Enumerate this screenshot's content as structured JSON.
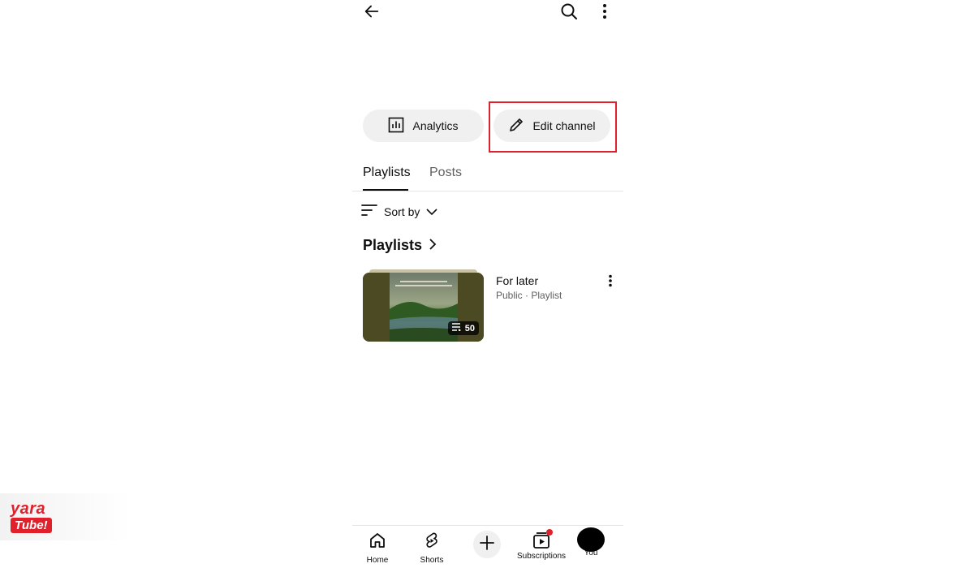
{
  "topbar": {
    "back_icon": "arrow-left-icon",
    "search_icon": "search-icon",
    "more_icon": "more-vertical-icon"
  },
  "actions": {
    "analytics_label": "Analytics",
    "analytics_icon": "bar-chart-icon",
    "edit_label": "Edit channel",
    "edit_icon": "pencil-icon",
    "highlight_color": "#e0202b"
  },
  "tabs": [
    {
      "label": "Playlists",
      "active": true
    },
    {
      "label": "Posts",
      "active": false
    }
  ],
  "sort": {
    "label": "Sort by",
    "icon": "sort-lines-icon"
  },
  "section": {
    "title": "Playlists"
  },
  "playlist": {
    "title": "For later",
    "meta": "Public · Playlist",
    "count": "50",
    "thumbnail_caption": "life is a journey, enjoy it in beautiful life"
  },
  "bottom_nav": {
    "items": [
      {
        "label": "Home",
        "icon": "home-icon"
      },
      {
        "label": "Shorts",
        "icon": "shorts-icon"
      },
      {
        "label": "",
        "icon": "plus-icon"
      },
      {
        "label": "Subscriptions",
        "icon": "subscriptions-icon"
      },
      {
        "label": "You",
        "icon": "avatar-icon"
      }
    ]
  },
  "watermark": {
    "line1": "yara",
    "line2": "Tube!",
    "brand_color": "#e0202b"
  }
}
